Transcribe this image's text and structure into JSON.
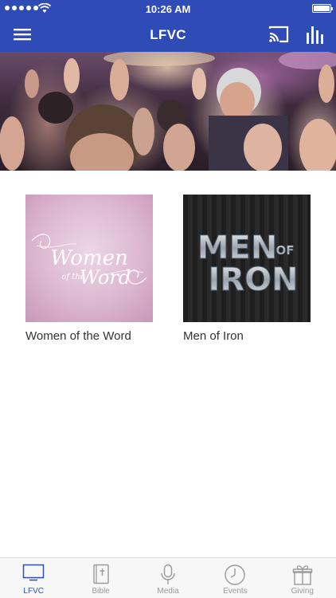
{
  "status_bar": {
    "time": "10:26 AM",
    "signal": "signal-dots",
    "wifi": "wifi-icon",
    "battery": "battery-icon"
  },
  "nav": {
    "title": "LFVC",
    "menu_icon": "hamburger-icon",
    "cast_icon": "cast-icon",
    "stats_icon": "bar-chart-icon"
  },
  "hero": {
    "image": "worship-crowd-photo"
  },
  "cards": [
    {
      "label": "Women of the Word",
      "image_text": [
        "Women",
        "of the",
        "Word"
      ]
    },
    {
      "label": "Men of Iron",
      "image_text": [
        "MEN",
        "OF",
        "IRON"
      ]
    }
  ],
  "tabs": [
    {
      "label": "LFVC",
      "icon": "tv-icon",
      "active": true
    },
    {
      "label": "Bible",
      "icon": "bible-icon",
      "active": false
    },
    {
      "label": "Media",
      "icon": "microphone-icon",
      "active": false
    },
    {
      "label": "Events",
      "icon": "clock-icon",
      "active": false
    },
    {
      "label": "Giving",
      "icon": "gift-icon",
      "active": false
    }
  ],
  "colors": {
    "primary": "#2f4bb5",
    "tab_inactive": "#999999",
    "card_text": "#333333"
  }
}
